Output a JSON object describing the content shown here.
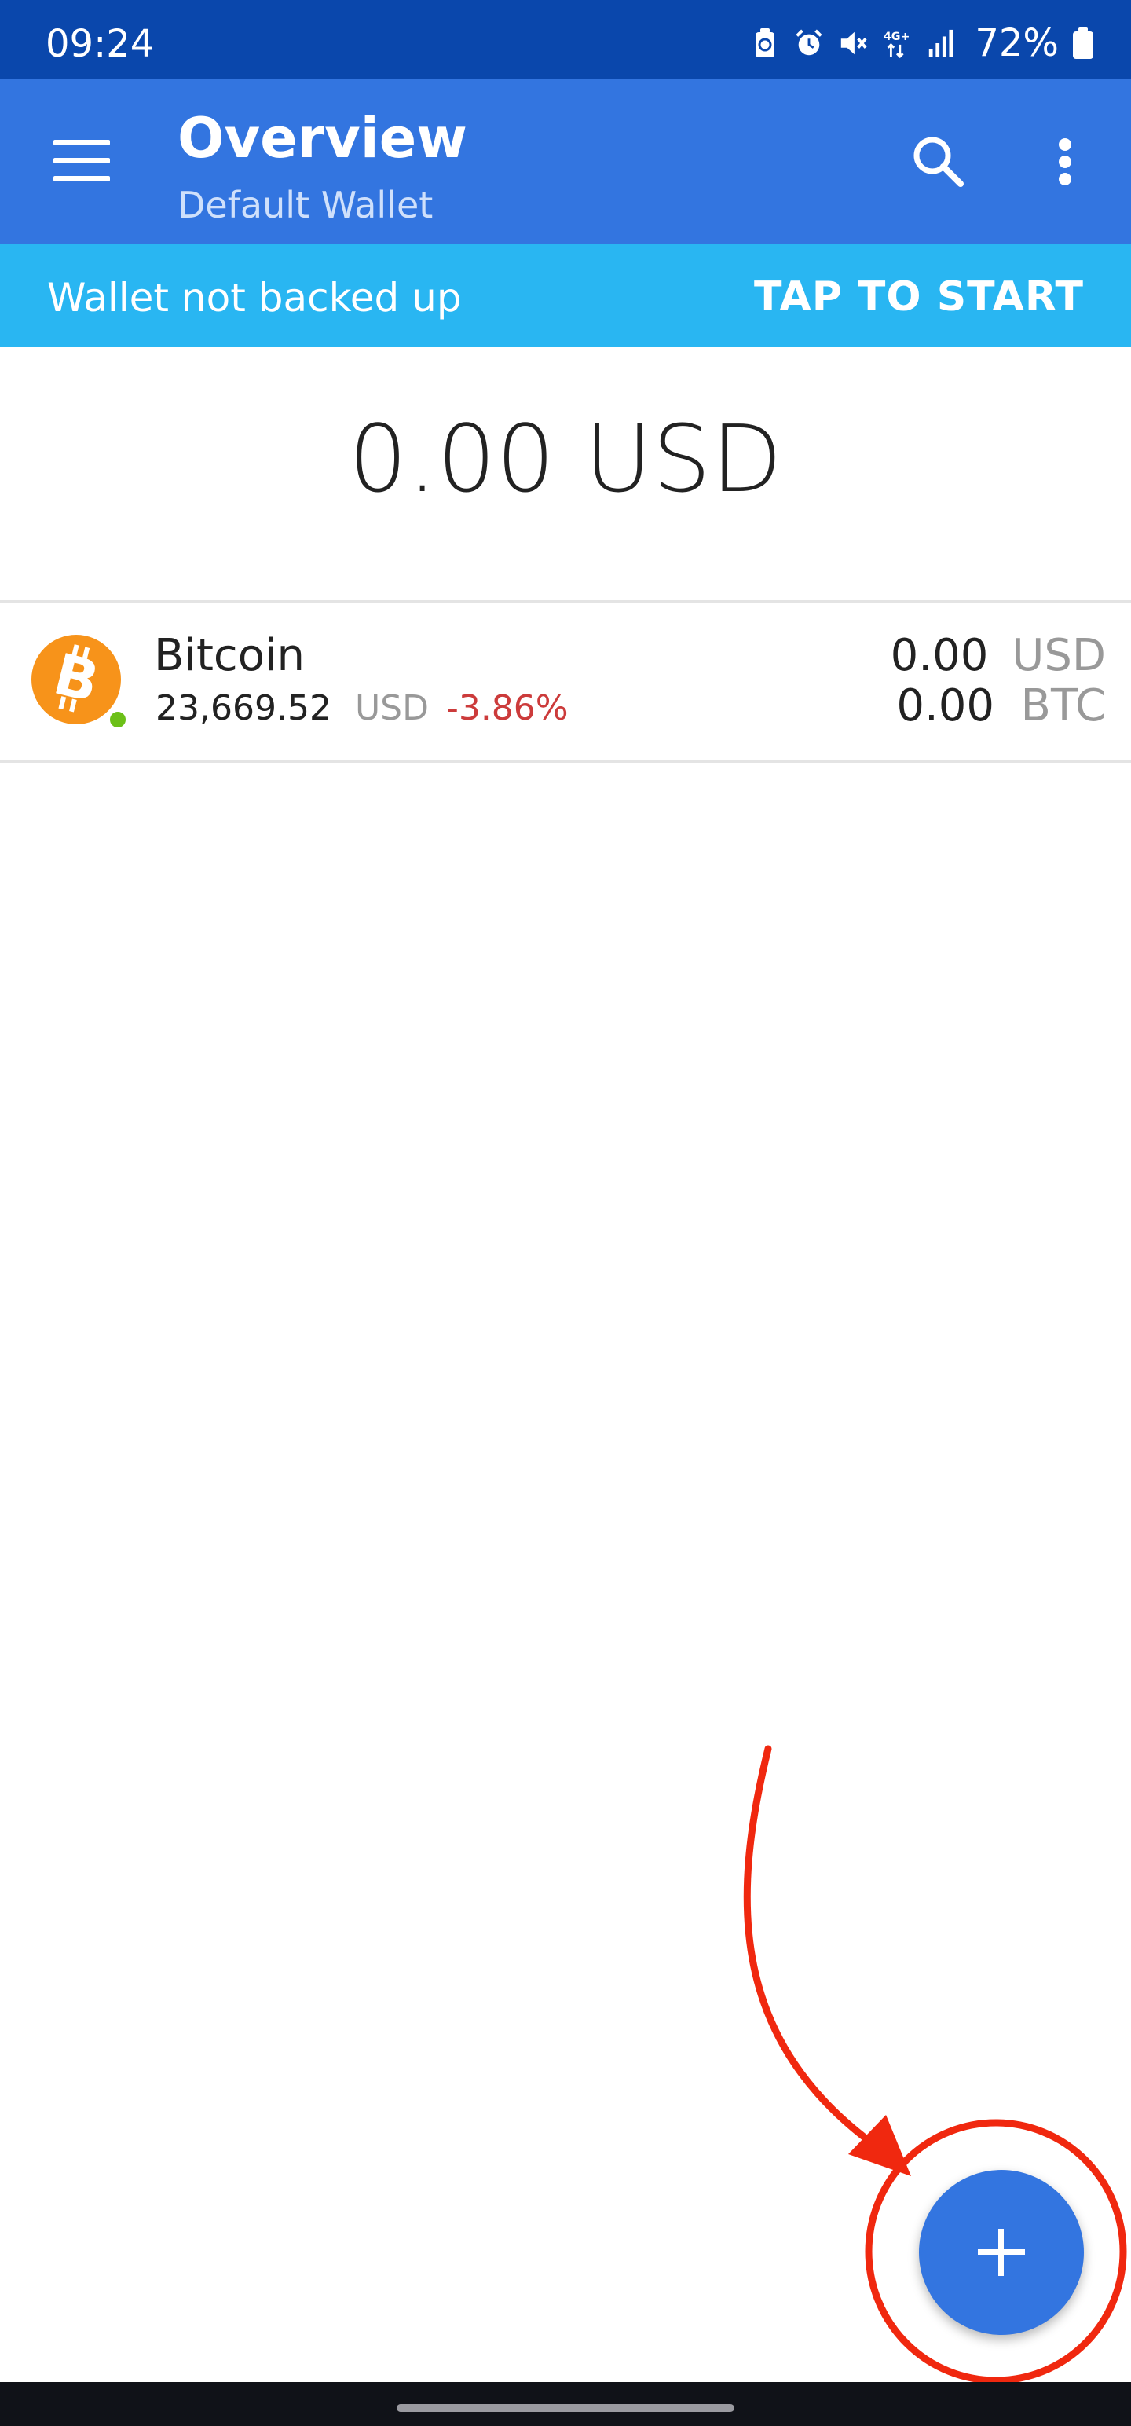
{
  "status_bar": {
    "time": "09:24",
    "battery_percent": "72%",
    "icons": [
      "battery-saver-icon",
      "alarm-icon",
      "mute-icon",
      "4g-plus-icon",
      "signal-icon",
      "battery-icon"
    ]
  },
  "app_bar": {
    "title": "Overview",
    "subtitle": "Default Wallet",
    "icons": [
      "menu-icon",
      "search-icon",
      "more-vert-icon"
    ],
    "color": "#3375e0"
  },
  "banner": {
    "message": "Wallet not backed up",
    "action": "TAP TO START",
    "color": "#29b6f2"
  },
  "total_balance": "0.00 USD",
  "assets": [
    {
      "name": "Bitcoin",
      "price": "23,669.52",
      "price_unit": "USD",
      "change": "-3.86%",
      "balance_fiat": "0.00",
      "fiat_unit": "USD",
      "balance_crypto": "0.00",
      "crypto_unit": "BTC",
      "icon": "bitcoin-icon",
      "status": "online"
    }
  ],
  "fab": {
    "icon": "plus-icon",
    "color": "#3375e0"
  },
  "annotation": {
    "color": "#f0280f",
    "marks": [
      "red-circle",
      "red-arrow"
    ]
  }
}
